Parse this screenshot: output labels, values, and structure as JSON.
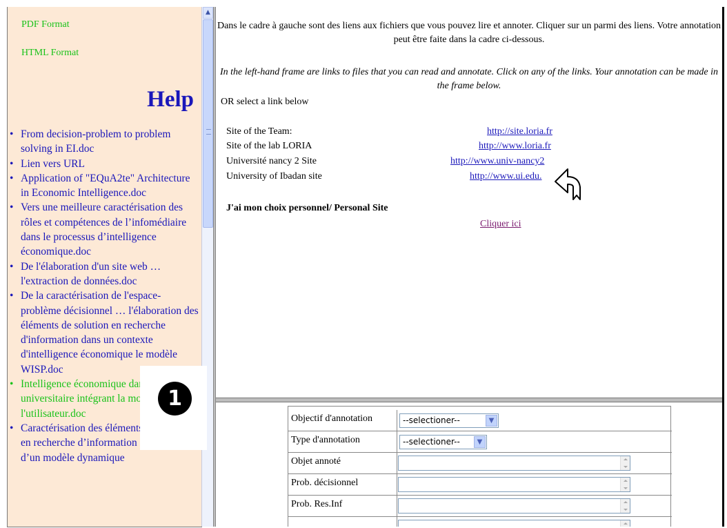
{
  "left_frame": {
    "format_links": [
      "PDF Format",
      "HTML Format"
    ],
    "help_title": "Help",
    "help_items": [
      {
        "text": "From decision-problem to problem solving in EI.doc",
        "color": "#1a17ba"
      },
      {
        "text": "Lien vers URL",
        "color": "#1a17ba"
      },
      {
        "text": "Application of \"EQuA2te\" Architecture in Economic Intelligence.doc",
        "color": "#1a17ba"
      },
      {
        "text": "Vers une meilleure caractérisation des rôles et compétences de l’infomédiaire dans le processus d’intelligence économique.doc",
        "color": "#1a17ba"
      },
      {
        "text": "De l'élaboration d'un site web … l'extraction de données.doc",
        "color": "#1a17ba"
      },
      {
        "text": "De la caractérisation de l'espace-problème décisionnel … l'élaboration des éléments de solution en recherche d'information dans un contexte d'intelligence économique le modèle WISP.doc",
        "color": "#1a17ba"
      },
      {
        "text": "Intelligence économique dans un système universitaire intégrant la modélisation de l'utilisateur.doc",
        "color": "#19c219"
      },
      {
        "text": "Caractérisation des éléments de solutions en recherche d’information : conception d’un modèle dynamique",
        "color": "#1a17ba"
      }
    ],
    "badge": "1"
  },
  "top_frame": {
    "intro_fr": "Dans le cadre à gauche sont des liens aux fichiers que vous pouvez lire et annoter. Cliquer sur un parmi des liens. Votre annotation peut être faite dans la cadre ci-dessous.",
    "intro_en": "In the left-hand frame are links to files that you can read and annotate. Click on any of the links. Your annotation can be made in the frame below.",
    "or_select": "OR select a link below",
    "sites": [
      {
        "label": "Site of the Team:",
        "url": "http://site.loria.fr"
      },
      {
        "label": "Site of the lab LORIA",
        "url": "http://www.loria.fr"
      },
      {
        "label": "Université nancy 2 Site",
        "url": "http://www.univ-nancy2"
      },
      {
        "label": "University of Ibadan site",
        "url": "http://www.ui.edu."
      }
    ],
    "personal_site": "J'ai mon choix personnel/ Personal Site",
    "personal_link": "Cliquer ici"
  },
  "bottom_frame": {
    "rows": [
      {
        "label": "Objectif d'annotation",
        "type": "select",
        "value": "--selectioner--"
      },
      {
        "label": "Type d'annotation",
        "type": "select",
        "value": "--selectioner--"
      },
      {
        "label": "Objet annoté",
        "type": "text",
        "value": ""
      },
      {
        "label": "Prob. décisionnel",
        "type": "text",
        "value": ""
      },
      {
        "label": "Prob. Res.Inf",
        "type": "text",
        "value": ""
      },
      {
        "label": "",
        "type": "textarea",
        "value": ""
      }
    ]
  }
}
